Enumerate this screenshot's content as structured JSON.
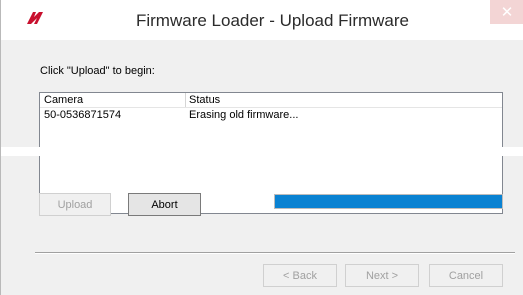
{
  "window": {
    "title": "Firmware Loader - Upload Firmware",
    "close_glyph": "✕",
    "logo_icon": "company-logo",
    "accent_color": "#0a82d2"
  },
  "main": {
    "prompt": "Click \"Upload\" to begin:",
    "table": {
      "columns": [
        "Camera",
        "Status"
      ],
      "rows": [
        [
          "50-0536871574",
          "Erasing old firmware..."
        ]
      ]
    },
    "upload_label": "Upload",
    "abort_label": "Abort",
    "progress_fraction": 1.0
  },
  "footer": {
    "back_label": "< Back",
    "next_label": "Next >",
    "cancel_label": "Cancel"
  }
}
